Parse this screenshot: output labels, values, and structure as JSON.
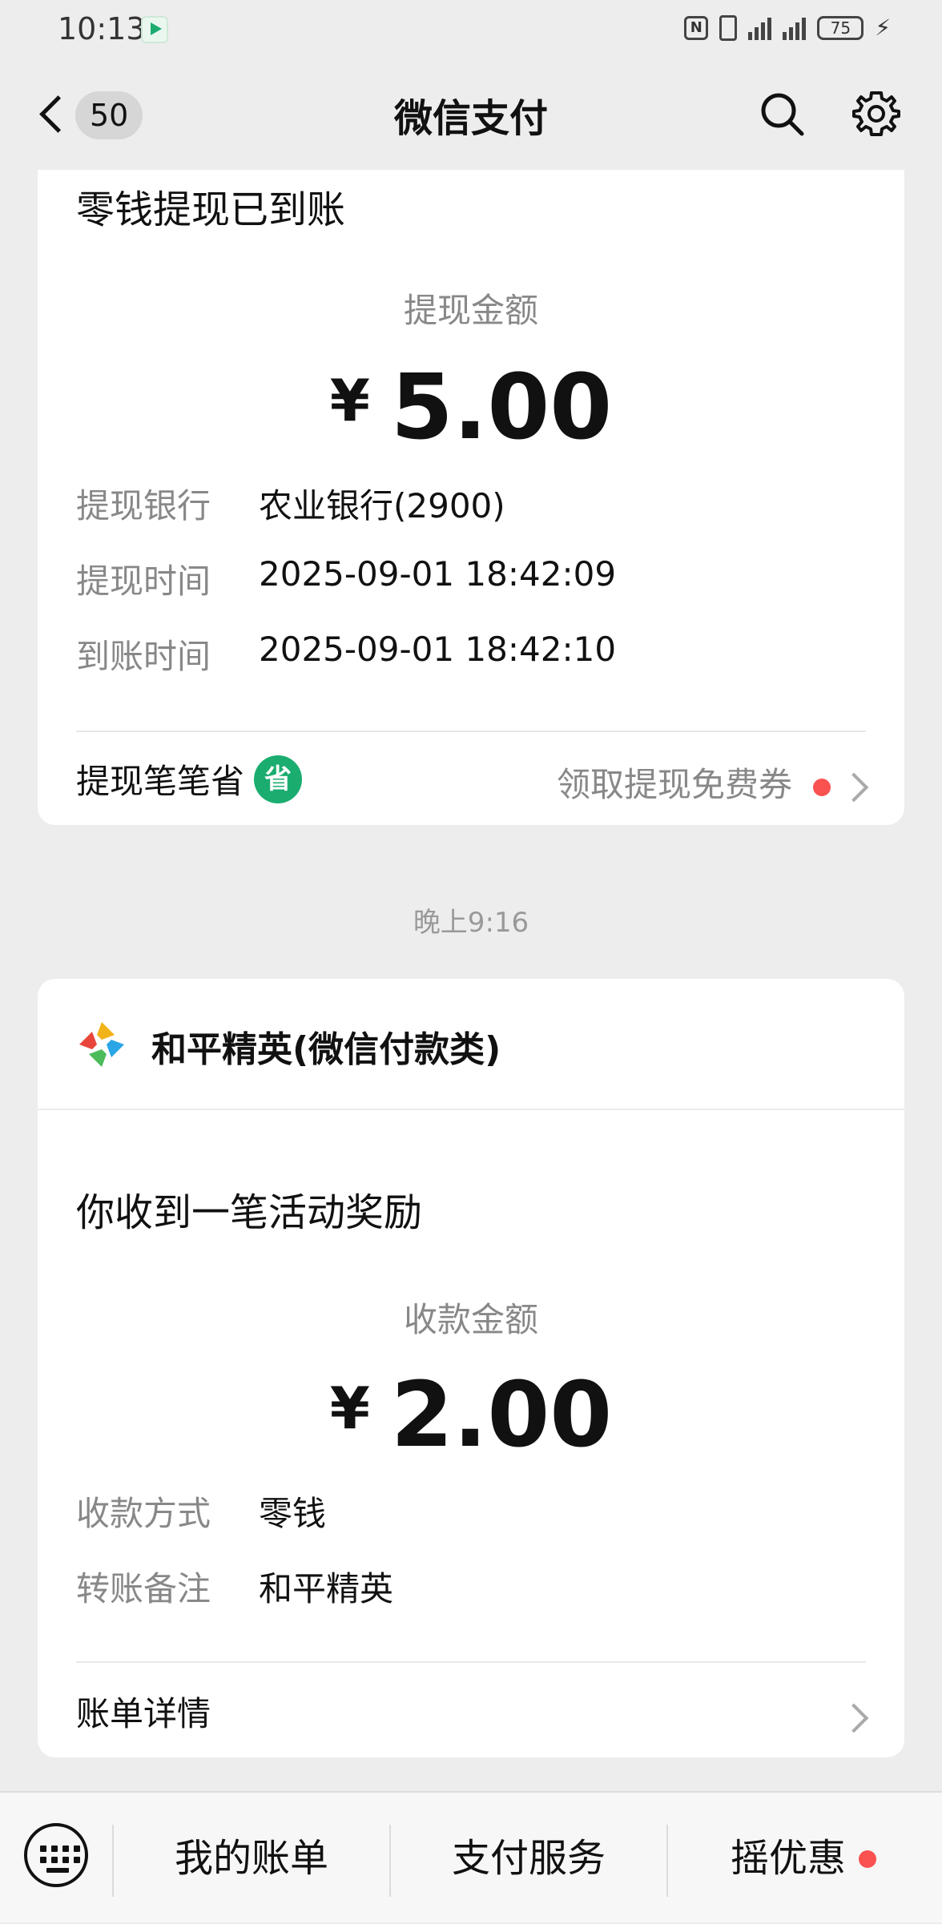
{
  "status_bar": {
    "time": "10:13",
    "battery": "75"
  },
  "nav": {
    "back_count": "50",
    "title": "微信支付"
  },
  "withdraw_card": {
    "title": "零钱提现已到账",
    "amount_label": "提现金额",
    "currency": "¥",
    "amount": "5.00",
    "rows": [
      {
        "key": "提现银行",
        "value": "农业银行(2900)"
      },
      {
        "key": "提现时间",
        "value": "2025-09-01 18:42:09"
      },
      {
        "key": "到账时间",
        "value": "2025-09-01 18:42:10"
      }
    ],
    "footer_left": "提现笔笔省",
    "footer_badge": "省",
    "footer_right": "领取提现免费券"
  },
  "time_separator": "晚上9:16",
  "reward_card": {
    "merchant": "和平精英(微信付款类)",
    "title": "你收到一笔活动奖励",
    "amount_label": "收款金额",
    "currency": "¥",
    "amount": "2.00",
    "rows": [
      {
        "key": "收款方式",
        "value": "零钱"
      },
      {
        "key": "转账备注",
        "value": "和平精英"
      }
    ],
    "footer": "账单详情"
  },
  "bottom_bar": {
    "tabs": [
      "我的账单",
      "支付服务",
      "摇优惠"
    ]
  },
  "colors": {
    "accent_green": "#1aad6f",
    "red_dot": "#fa5151",
    "background": "#ededed"
  }
}
